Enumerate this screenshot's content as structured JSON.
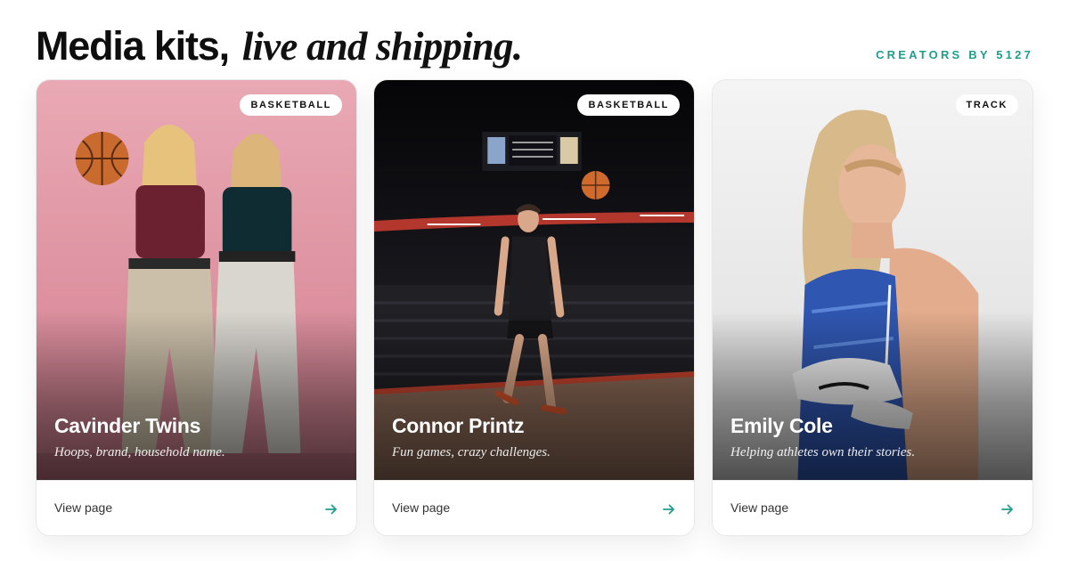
{
  "header": {
    "headline_bold": "Media kits,",
    "headline_italic": "live and shipping.",
    "eyebrow": "CREATORS BY 5127"
  },
  "colors": {
    "accent": "#1f9e8c"
  },
  "cards": [
    {
      "badge": "BASKETBALL",
      "name": "Cavinder Twins",
      "tagline": "Hoops, brand, household name.",
      "link_label": "View page",
      "link_icon": "arrow-right-icon"
    },
    {
      "badge": "BASKETBALL",
      "name": "Connor Printz",
      "tagline": "Fun games, crazy challenges.",
      "link_label": "View page",
      "link_icon": "arrow-right-icon"
    },
    {
      "badge": "TRACK",
      "name": "Emily Cole",
      "tagline": "Helping athletes own their stories.",
      "link_label": "View page",
      "link_icon": "arrow-right-icon"
    }
  ]
}
